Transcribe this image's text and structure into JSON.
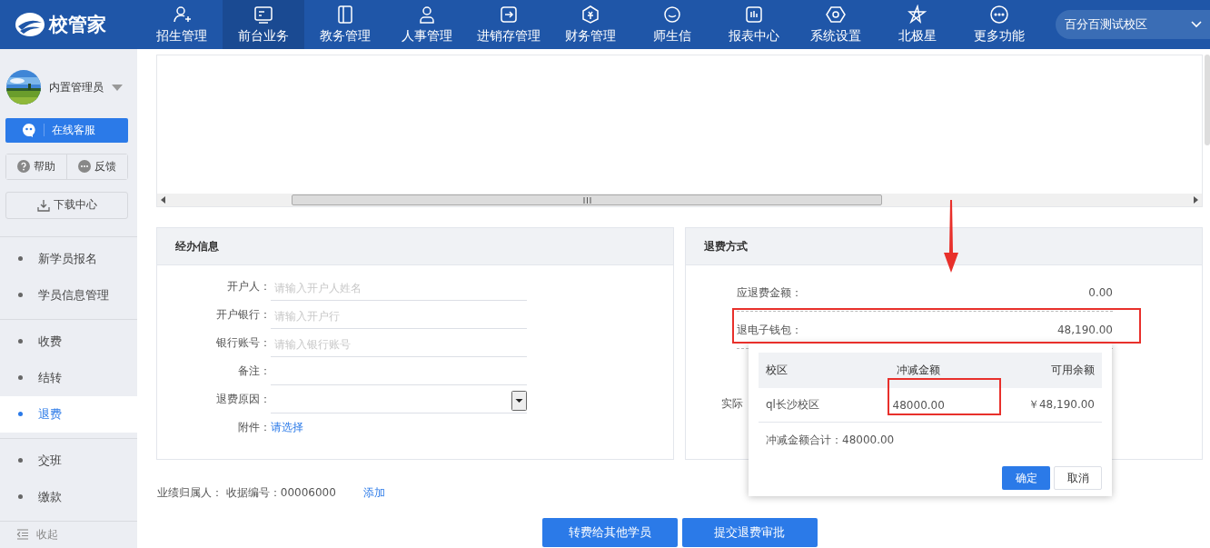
{
  "header": {
    "logo": "校管家",
    "nav": [
      {
        "label": "招生管理",
        "selected": false
      },
      {
        "label": "前台业务",
        "selected": true
      },
      {
        "label": "教务管理",
        "selected": false
      },
      {
        "label": "人事管理",
        "selected": false
      },
      {
        "label": "进销存管理",
        "selected": false
      },
      {
        "label": "财务管理",
        "selected": false
      },
      {
        "label": "师生信",
        "selected": false
      },
      {
        "label": "报表中心",
        "selected": false
      },
      {
        "label": "系统设置",
        "selected": false
      },
      {
        "label": "北极星",
        "selected": false
      },
      {
        "label": "更多功能",
        "selected": false
      }
    ],
    "campus": "百分百测试校区"
  },
  "sidebar": {
    "user": "内置管理员",
    "service": "在线客服",
    "help": "帮助",
    "feedback": "反馈",
    "download": "下载中心",
    "groups": [
      [
        {
          "label": "新学员报名",
          "selected": false
        },
        {
          "label": "学员信息管理",
          "selected": false
        }
      ],
      [
        {
          "label": "收费",
          "selected": false
        },
        {
          "label": "结转",
          "selected": false
        },
        {
          "label": "退费",
          "selected": true
        }
      ],
      [
        {
          "label": "交班",
          "selected": false
        },
        {
          "label": "缴款",
          "selected": false
        }
      ]
    ],
    "collapse": "收起"
  },
  "handler_panel": {
    "title": "经办信息",
    "fields": [
      {
        "kind": "text",
        "label": "开户人：",
        "placeholder": "请输入开户人姓名"
      },
      {
        "kind": "text",
        "label": "开户银行：",
        "placeholder": "请输入开户行"
      },
      {
        "kind": "text",
        "label": "银行账号：",
        "placeholder": "请输入银行账号"
      },
      {
        "kind": "text",
        "label": "备注："
      },
      {
        "kind": "select",
        "label": "退费原因："
      },
      {
        "kind": "link",
        "label": "附件：",
        "value": "请选择"
      }
    ]
  },
  "refund_panel": {
    "title": "退费方式",
    "rows": [
      {
        "label": "应退费金额：",
        "value": "0.00"
      },
      {
        "label": "退电子钱包：",
        "value": "48,190.00"
      }
    ],
    "covered_label": "实际"
  },
  "wallet_popup": {
    "columns": [
      "校区",
      "冲减金额",
      "可用余额"
    ],
    "rows": [
      {
        "campus": "ql长沙校区",
        "amount": "48000.00",
        "balance": "￥48,190.00"
      }
    ],
    "total": "冲减金额合计：48000.00",
    "buttons": [
      {
        "kind": "primary",
        "label": "确定"
      },
      {
        "kind": "secondary",
        "label": "取消"
      }
    ]
  },
  "footer": {
    "text": "业绩归属人： 收据编号：00006000",
    "link": "添加",
    "buttons": [
      "转费给其他学员",
      "提交退费审批"
    ]
  }
}
